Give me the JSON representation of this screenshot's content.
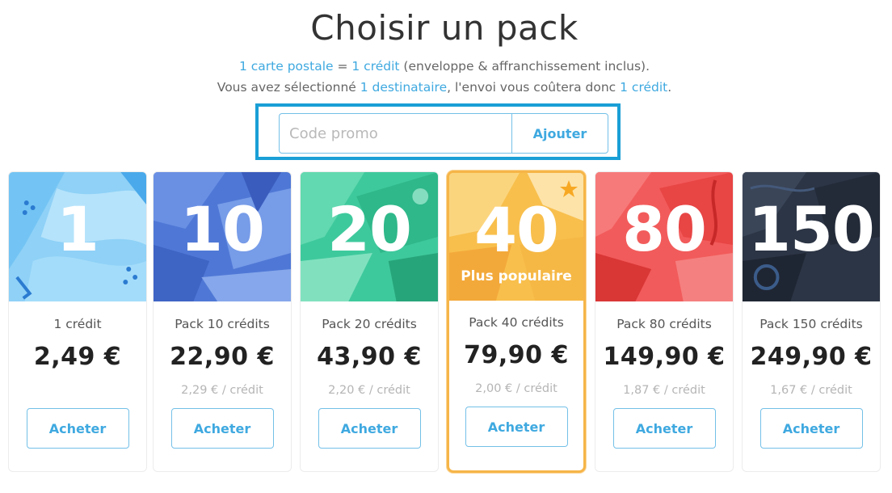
{
  "page": {
    "title": "Choisir un pack",
    "info_line1": {
      "a": "1 carte postale",
      "b": " = ",
      "c": "1 crédit",
      "d": " (enveloppe & affranchissement inclus)."
    },
    "info_line2": {
      "a": "Vous avez sélectionné ",
      "b": "1 destinataire",
      "c": ", l'envoi vous coûtera donc ",
      "d": "1 crédit",
      "e": "."
    }
  },
  "promo": {
    "placeholder": "Code promo",
    "value": "",
    "button_label": "Ajouter"
  },
  "colors": {
    "accent": "#3fa9e0",
    "highlight_frame": "#1a9fd6",
    "featured_border": "#f6b548"
  },
  "packs": [
    {
      "number": "1",
      "name": "1 crédit",
      "price": "2,49 €",
      "unit_price": "",
      "button": "Acheter",
      "theme": "light-blue"
    },
    {
      "number": "10",
      "name": "Pack 10 crédits",
      "price": "22,90 €",
      "unit_price": "2,29 € / crédit",
      "button": "Acheter",
      "theme": "blue"
    },
    {
      "number": "20",
      "name": "Pack 20 crédits",
      "price": "43,90 €",
      "unit_price": "2,20 € / crédit",
      "button": "Acheter",
      "theme": "green"
    },
    {
      "number": "40",
      "name": "Pack 40 crédits",
      "price": "79,90 €",
      "unit_price": "2,00 € / crédit",
      "button": "Acheter",
      "theme": "yellow",
      "badge": "Plus populaire",
      "icon": "star-icon"
    },
    {
      "number": "80",
      "name": "Pack 80 crédits",
      "price": "149,90 €",
      "unit_price": "1,87 € / crédit",
      "button": "Acheter",
      "theme": "red"
    },
    {
      "number": "150",
      "name": "Pack 150 crédits",
      "price": "249,90 €",
      "unit_price": "1,67 € / crédit",
      "button": "Acheter",
      "theme": "dark"
    }
  ]
}
